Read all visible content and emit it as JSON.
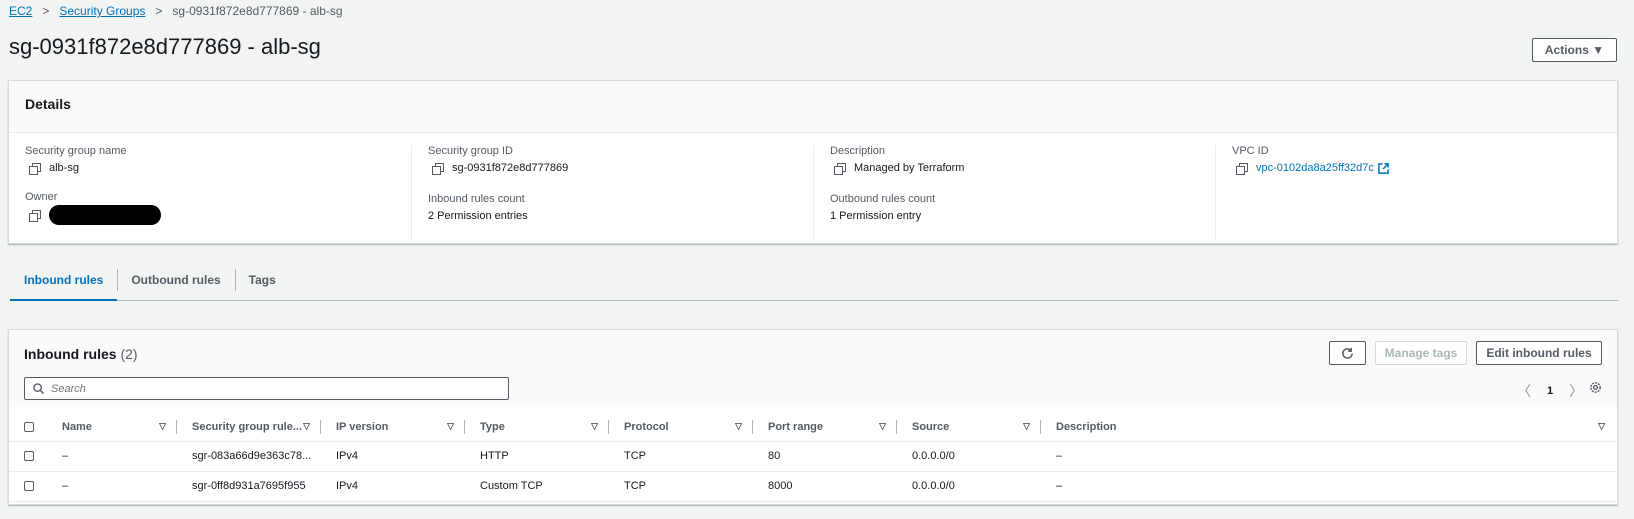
{
  "breadcrumb": {
    "items": [
      "EC2",
      "Security Groups"
    ],
    "current": "sg-0931f872e8d777869 - alb-sg",
    "separator": ">"
  },
  "page": {
    "title": "sg-0931f872e8d777869 - alb-sg",
    "actions_label": "Actions ▼"
  },
  "details": {
    "heading": "Details",
    "fields": {
      "sg_name": {
        "label": "Security group name",
        "value": "alb-sg"
      },
      "sg_id": {
        "label": "Security group ID",
        "value": "sg-0931f872e8d777869"
      },
      "description": {
        "label": "Description",
        "value": "Managed by Terraform"
      },
      "vpc_id": {
        "label": "VPC ID",
        "value": "vpc-0102da8a25ff32d7c"
      },
      "owner": {
        "label": "Owner"
      },
      "inbound_count": {
        "label": "Inbound rules count",
        "value": "2 Permission entries"
      },
      "outbound_count": {
        "label": "Outbound rules count",
        "value": "1 Permission entry"
      }
    }
  },
  "tabs": [
    "Inbound rules",
    "Outbound rules",
    "Tags"
  ],
  "rules": {
    "title": "Inbound rules",
    "count": "(2)",
    "manage_tags_label": "Manage tags",
    "edit_label": "Edit inbound rules",
    "search_placeholder": "Search",
    "page_number": "1",
    "columns": [
      "Name",
      "Security group rule...",
      "IP version",
      "Type",
      "Protocol",
      "Port range",
      "Source",
      "Description"
    ],
    "rows": [
      {
        "name": "–",
        "rule_id": "sgr-083a66d9e363c78...",
        "ip_version": "IPv4",
        "type": "HTTP",
        "protocol": "TCP",
        "port_range": "80",
        "source": "0.0.0.0/0",
        "description": "–"
      },
      {
        "name": "–",
        "rule_id": "sgr-0ff8d931a7695f955",
        "ip_version": "IPv4",
        "type": "Custom TCP",
        "protocol": "TCP",
        "port_range": "8000",
        "source": "0.0.0.0/0",
        "description": "–"
      }
    ]
  },
  "colors": {
    "link": "#0073bb",
    "background": "#f2f3f3",
    "text": "#16191f",
    "muted": "#545b64"
  },
  "icons": [
    "copy-icon",
    "external-link-icon",
    "refresh-icon",
    "search-icon",
    "gear-icon",
    "chevron-left-icon",
    "chevron-right-icon",
    "sort-icon"
  ]
}
